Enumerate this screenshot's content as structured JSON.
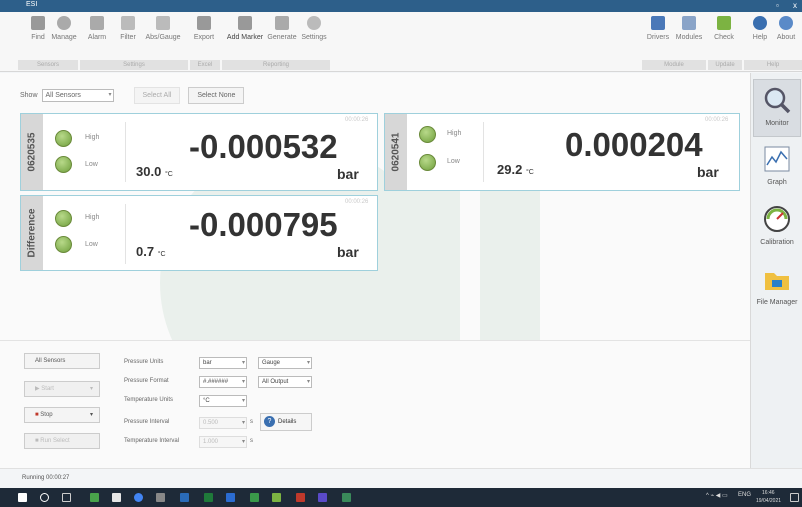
{
  "titlebar": {
    "title": "ESI",
    "controls": [
      "▫",
      "x"
    ]
  },
  "ribbon": {
    "buttons": [
      {
        "label": "Find",
        "icon": "binoculars-icon",
        "color": "#888"
      },
      {
        "label": "Manage",
        "icon": "gear-icon",
        "color": "#999"
      },
      {
        "label": "Alarm",
        "icon": "alarm-icon",
        "color": "#999"
      },
      {
        "label": "Filter",
        "icon": "filter-icon",
        "color": "#aaa"
      },
      {
        "label": "Abs/Gauge",
        "icon": "abs-gauge-icon",
        "color": "#aaa"
      },
      {
        "label": "Export",
        "icon": "export-icon",
        "color": "#999"
      },
      {
        "label": "Add Marker",
        "icon": "marker-icon",
        "color": "#999"
      },
      {
        "label": "Generate",
        "icon": "generate-icon",
        "color": "#aaa"
      },
      {
        "label": "Settings",
        "icon": "settings-icon",
        "color": "#aaa"
      },
      {
        "label": "Drivers",
        "icon": "drivers-icon",
        "color": "#4a78b8"
      },
      {
        "label": "Modules",
        "icon": "modules-icon",
        "color": "#8aa4c8"
      },
      {
        "label": "Check",
        "icon": "check-icon",
        "color": "#7cb342"
      },
      {
        "label": "Help",
        "icon": "help-icon",
        "color": "#3a6fb0"
      },
      {
        "label": "About",
        "icon": "about-icon",
        "color": "#5a8ac8"
      }
    ],
    "groups": [
      "Sensors",
      "Settings",
      "Excel",
      "Reporting",
      "Module",
      "Update",
      "Help"
    ]
  },
  "filter": {
    "show_label": "Show",
    "show_value": "All Sensors",
    "select_all": "Select All",
    "select_none": "Select None"
  },
  "cards": [
    {
      "name": "0620535",
      "value": "-0.000532",
      "unit": "bar",
      "temp": "30.0",
      "temp_unit": "°C",
      "timer": "00:00:26",
      "high": "High",
      "low": "Low"
    },
    {
      "name": "0620541",
      "value": "0.000204",
      "unit": "bar",
      "temp": "29.2",
      "temp_unit": "°C",
      "timer": "00:00:26",
      "high": "High",
      "low": "Low"
    },
    {
      "name": "Difference",
      "value": "-0.000795",
      "unit": "bar",
      "temp": "0.7",
      "temp_unit": "°C",
      "timer": "00:00:26",
      "high": "High",
      "low": "Low"
    }
  ],
  "side": {
    "monitor": "Monitor",
    "graph": "Graph",
    "calibration": "Calibration",
    "file_manager": "File Manager"
  },
  "controls": {
    "all_sensors": "All Sensors",
    "start": "Start",
    "stop": "Stop",
    "run_select": "Run Select",
    "pressure_units_label": "Pressure Units",
    "pressure_units_value": "bar",
    "pressure_type_value": "Gauge",
    "pressure_format_label": "Pressure Format",
    "pressure_format_value": "#.######",
    "output_value": "All Output",
    "temp_units_label": "Temperature Units",
    "temp_units_value": "°C",
    "pressure_interval_label": "Pressure Interval",
    "pressure_interval_value": "0.500",
    "pressure_interval_unit": "s",
    "details": "Details",
    "temp_interval_label": "Temperature Interval",
    "temp_interval_value": "1.000",
    "temp_interval_unit": "s"
  },
  "status": {
    "text": "Running 00:00:27"
  },
  "taskbar": {
    "lang": "ENG",
    "time": "16:46",
    "date": "19/04/2021"
  }
}
